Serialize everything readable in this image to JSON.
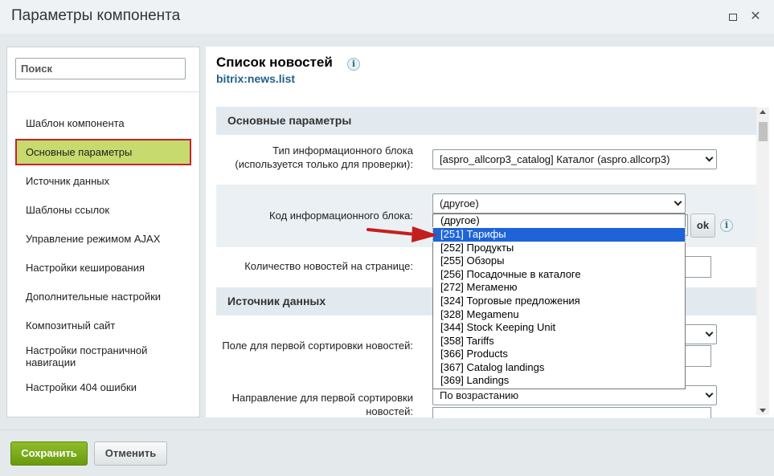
{
  "window": {
    "title": "Параметры компонента"
  },
  "sidebar": {
    "search_placeholder": "Поиск",
    "items": [
      {
        "label": "Шаблон компонента"
      },
      {
        "label": "Основные параметры"
      },
      {
        "label": "Источник данных"
      },
      {
        "label": "Шаблоны ссылок"
      },
      {
        "label": "Управление режимом AJAX"
      },
      {
        "label": "Настройки кеширования"
      },
      {
        "label": "Дополнительные настройки"
      },
      {
        "label": "Композитный сайт"
      },
      {
        "label": "Настройки постраничной навигации"
      },
      {
        "label": "Настройки 404 ошибки"
      }
    ],
    "active_index": 1
  },
  "component": {
    "title": "Список новостей",
    "code": "bitrix:news.list"
  },
  "sections": {
    "main_params": "Основные параметры",
    "data_source": "Источник данных"
  },
  "fields": {
    "iblock_type_label": "Тип информационного блока (используется только для проверки):",
    "iblock_type_value": "[aspro_allcorp3_catalog] Каталог (aspro.allcorp3)",
    "iblock_code_label": "Код информационного блока:",
    "iblock_code_value": "(другое)",
    "ok_label": "ok",
    "news_count_label": "Количество новостей на странице:",
    "sort1_label": "Поле для первой сортировки новостей:",
    "sort1_dir_label": "Направление для первой сортировки новостей:",
    "sort1_dir_value": "По возрастанию"
  },
  "dropdown": {
    "options": [
      "(другое)",
      "[251] Тарифы",
      "[252] Продукты",
      "[255] Обзоры",
      "[256] Посадочные в каталоге",
      "[272] Мегаменю",
      "[324] Торговые предложения",
      "[328] Megamenu",
      "[344] Stock Keeping Unit",
      "[358] Tariffs",
      "[366] Products",
      "[367] Catalog landings",
      "[369] Landings"
    ],
    "highlighted": "[251] Тарифы"
  },
  "footer": {
    "save_label": "Сохранить",
    "cancel_label": "Отменить"
  },
  "colors": {
    "active_nav": "#c7da6e",
    "active_nav_border": "#c4242a",
    "save_button": "#7aab18",
    "dropdown_highlight": "#1e64d8",
    "annotation_arrow": "#c41e1e"
  }
}
